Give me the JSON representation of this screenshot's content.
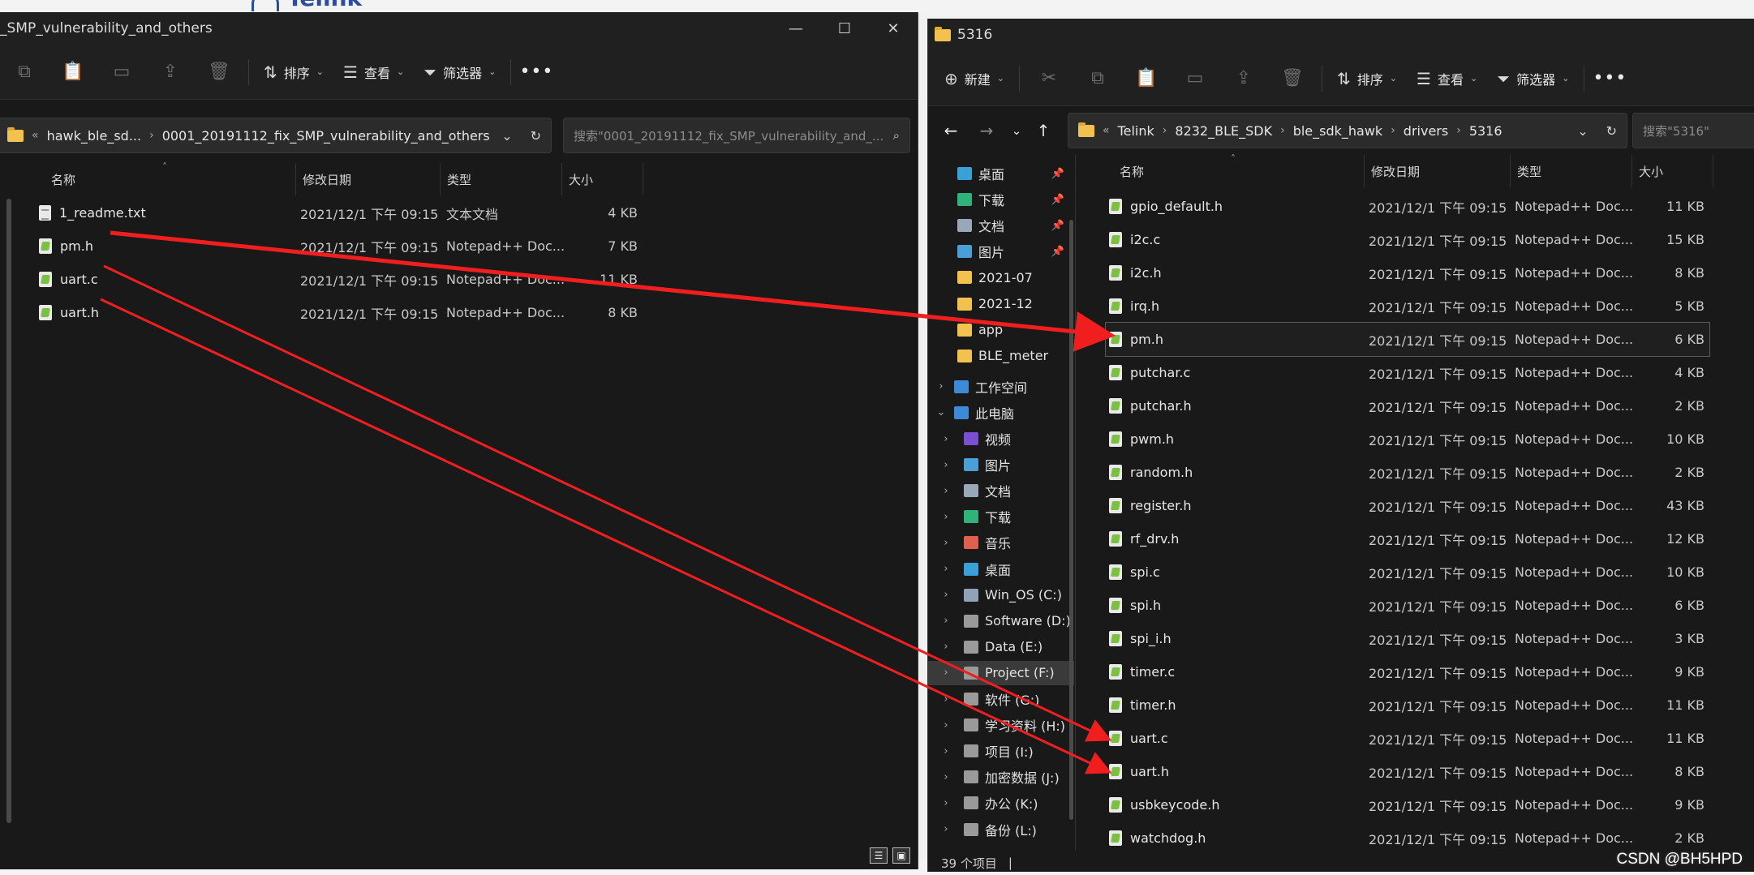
{
  "background": {
    "logo_text": "Telink",
    "watermark": "CSDN @BH5HPD"
  },
  "left_window": {
    "title": "_SMP_vulnerability_and_others",
    "controls": [
      "—",
      "☐",
      "✕"
    ],
    "toolbar": {
      "sort": "排序",
      "view": "查看",
      "filter": "筛选器",
      "more": "•••"
    },
    "breadcrumb": [
      "hawk_ble_sd...",
      "0001_20191112_fix_SMP_vulnerability_and_others"
    ],
    "search_placeholder": "搜索\"0001_20191112_fix_SMP_vulnerability_and_...",
    "columns": {
      "name": "名称",
      "date": "修改日期",
      "type": "类型",
      "size": "大小"
    },
    "files": [
      {
        "name": "1_readme.txt",
        "date": "2021/12/1 下午 09:15",
        "type": "文本文档",
        "size": "4 KB",
        "icon": "text-file-icon"
      },
      {
        "name": "pm.h",
        "date": "2021/12/1 下午 09:15",
        "type": "Notepad++ Doc...",
        "size": "7 KB",
        "icon": "notepad-file-icon"
      },
      {
        "name": "uart.c",
        "date": "2021/12/1 下午 09:15",
        "type": "Notepad++ Doc...",
        "size": "11 KB",
        "icon": "notepad-file-icon"
      },
      {
        "name": "uart.h",
        "date": "2021/12/1 下午 09:15",
        "type": "Notepad++ Doc...",
        "size": "8 KB",
        "icon": "notepad-file-icon"
      }
    ]
  },
  "right_window": {
    "title": "5316",
    "toolbar": {
      "new": "新建",
      "sort": "排序",
      "view": "查看",
      "filter": "筛选器",
      "more": "•••"
    },
    "breadcrumb": [
      "Telink",
      "8232_BLE_SDK",
      "ble_sdk_hawk",
      "drivers",
      "5316"
    ],
    "search_placeholder": "搜索\"5316\"",
    "nav_pane": [
      {
        "label": "桌面",
        "color": "#3aa0d8",
        "pinned": true
      },
      {
        "label": "下载",
        "color": "#2fb37a",
        "pinned": true
      },
      {
        "label": "文档",
        "color": "#9aa7b8",
        "pinned": true
      },
      {
        "label": "图片",
        "color": "#4a9fd6",
        "pinned": true
      },
      {
        "label": "2021-07",
        "color": "#f2c14e"
      },
      {
        "label": "2021-12",
        "color": "#f2c14e"
      },
      {
        "label": "app",
        "color": "#f2c14e"
      },
      {
        "label": "BLE_meter",
        "color": "#f2c14e"
      },
      {
        "label": "工作空间",
        "color": "#3d8bd6",
        "expander": "›"
      },
      {
        "label": "此电脑",
        "color": "#3d8bd6",
        "expander": "⌄"
      },
      {
        "label": "视频",
        "color": "#7b4fd1",
        "expander": "›"
      },
      {
        "label": "图片",
        "color": "#4a9fd6",
        "expander": "›"
      },
      {
        "label": "文档",
        "color": "#9aa7b8",
        "expander": "›"
      },
      {
        "label": "下载",
        "color": "#2fb37a",
        "expander": "›"
      },
      {
        "label": "音乐",
        "color": "#e0604f",
        "expander": "›"
      },
      {
        "label": "桌面",
        "color": "#3aa0d8",
        "expander": "›"
      },
      {
        "label": "Win_OS (C:)",
        "color": "#8fa2b8",
        "expander": "›"
      },
      {
        "label": "Software (D:)",
        "color": "#9a9a9a",
        "expander": "›"
      },
      {
        "label": "Data (E:)",
        "color": "#9a9a9a",
        "expander": "›"
      },
      {
        "label": "Project (F:)",
        "color": "#9a9a9a",
        "expander": "›",
        "selected": true
      },
      {
        "label": "软件 (G:)",
        "color": "#9a9a9a",
        "expander": "›"
      },
      {
        "label": "学习资料 (H:)",
        "color": "#9a9a9a",
        "expander": "›"
      },
      {
        "label": "项目 (I:)",
        "color": "#9a9a9a",
        "expander": "›"
      },
      {
        "label": "加密数据 (J:)",
        "color": "#9a9a9a",
        "expander": "›"
      },
      {
        "label": "办公 (K:)",
        "color": "#9a9a9a",
        "expander": "›"
      },
      {
        "label": "备份 (L:)",
        "color": "#9a9a9a",
        "expander": "›"
      }
    ],
    "columns": {
      "name": "名称",
      "date": "修改日期",
      "type": "类型",
      "size": "大小"
    },
    "files": [
      {
        "name": "gpio_default.h",
        "date": "2021/12/1 下午 09:15",
        "type": "Notepad++ Doc...",
        "size": "11 KB"
      },
      {
        "name": "i2c.c",
        "date": "2021/12/1 下午 09:15",
        "type": "Notepad++ Doc...",
        "size": "15 KB"
      },
      {
        "name": "i2c.h",
        "date": "2021/12/1 下午 09:15",
        "type": "Notepad++ Doc...",
        "size": "8 KB"
      },
      {
        "name": "irq.h",
        "date": "2021/12/1 下午 09:15",
        "type": "Notepad++ Doc...",
        "size": "5 KB"
      },
      {
        "name": "pm.h",
        "date": "2021/12/1 下午 09:15",
        "type": "Notepad++ Doc...",
        "size": "6 KB",
        "selected": true
      },
      {
        "name": "putchar.c",
        "date": "2021/12/1 下午 09:15",
        "type": "Notepad++ Doc...",
        "size": "4 KB"
      },
      {
        "name": "putchar.h",
        "date": "2021/12/1 下午 09:15",
        "type": "Notepad++ Doc...",
        "size": "2 KB"
      },
      {
        "name": "pwm.h",
        "date": "2021/12/1 下午 09:15",
        "type": "Notepad++ Doc...",
        "size": "10 KB"
      },
      {
        "name": "random.h",
        "date": "2021/12/1 下午 09:15",
        "type": "Notepad++ Doc...",
        "size": "2 KB"
      },
      {
        "name": "register.h",
        "date": "2021/12/1 下午 09:15",
        "type": "Notepad++ Doc...",
        "size": "43 KB"
      },
      {
        "name": "rf_drv.h",
        "date": "2021/12/1 下午 09:15",
        "type": "Notepad++ Doc...",
        "size": "12 KB"
      },
      {
        "name": "spi.c",
        "date": "2021/12/1 下午 09:15",
        "type": "Notepad++ Doc...",
        "size": "10 KB"
      },
      {
        "name": "spi.h",
        "date": "2021/12/1 下午 09:15",
        "type": "Notepad++ Doc...",
        "size": "6 KB"
      },
      {
        "name": "spi_i.h",
        "date": "2021/12/1 下午 09:15",
        "type": "Notepad++ Doc...",
        "size": "3 KB"
      },
      {
        "name": "timer.c",
        "date": "2021/12/1 下午 09:15",
        "type": "Notepad++ Doc...",
        "size": "9 KB"
      },
      {
        "name": "timer.h",
        "date": "2021/12/1 下午 09:15",
        "type": "Notepad++ Doc...",
        "size": "11 KB"
      },
      {
        "name": "uart.c",
        "date": "2021/12/1 下午 09:15",
        "type": "Notepad++ Doc...",
        "size": "11 KB"
      },
      {
        "name": "uart.h",
        "date": "2021/12/1 下午 09:15",
        "type": "Notepad++ Doc...",
        "size": "8 KB"
      },
      {
        "name": "usbkeycode.h",
        "date": "2021/12/1 下午 09:15",
        "type": "Notepad++ Doc...",
        "size": "9 KB"
      },
      {
        "name": "watchdog.h",
        "date": "2021/12/1 下午 09:15",
        "type": "Notepad++ Doc...",
        "size": "2 KB"
      }
    ],
    "status": "39 个项目",
    "status_sep": "|"
  },
  "annotation": {
    "arrow_color": "#f01e1e"
  }
}
